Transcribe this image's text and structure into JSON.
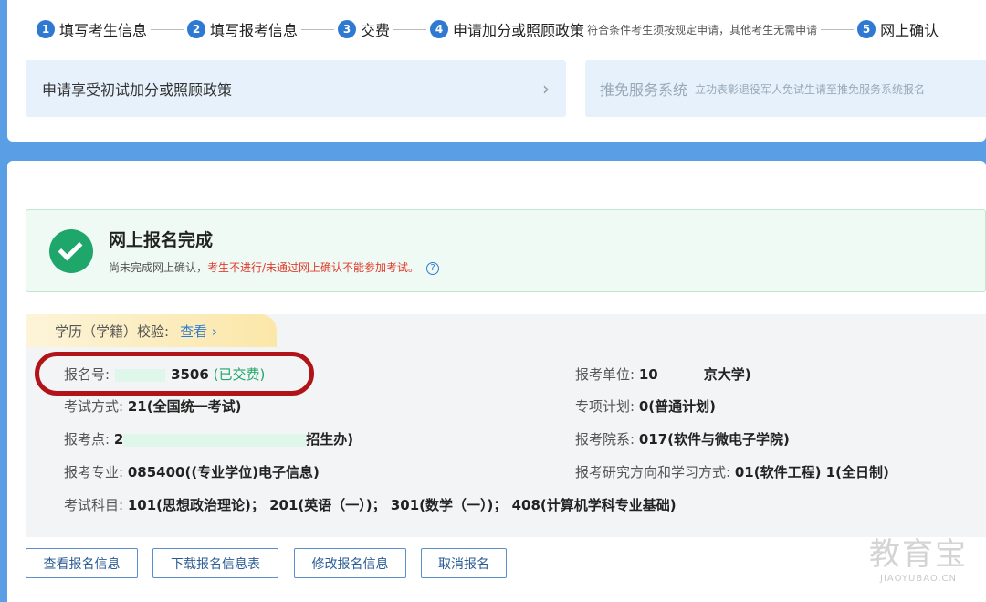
{
  "steps": [
    {
      "num": "1",
      "label": "填写考生信息"
    },
    {
      "num": "2",
      "label": "填写报考信息"
    },
    {
      "num": "3",
      "label": "交费"
    },
    {
      "num": "4",
      "label": "申请加分或照顾政策",
      "note": "符合条件考生须按规定申请，其他考生无需申请"
    },
    {
      "num": "5",
      "label": "网上确认"
    }
  ],
  "panels": {
    "bonus": {
      "label": "申请享受初试加分或照顾政策"
    },
    "exempt": {
      "title": "推免服务系统",
      "subtitle": "立功表彰退役军人免试生请至推免服务系统报名"
    }
  },
  "success": {
    "title": "网上报名完成",
    "sub_prefix": "尚未完成网上确认，",
    "sub_warning": "考生不进行/未通过网上确认不能参加考试。",
    "help": "?"
  },
  "education_tab": {
    "label": "学历（学籍）校验:",
    "link": "查看 ›"
  },
  "fields": {
    "reg_no": {
      "label": "报名号:",
      "value": "3506",
      "status": "(已交费)"
    },
    "exam_mode": {
      "label": "考试方式:",
      "value": "21(全国统一考试)"
    },
    "exam_site": {
      "label": "报考点:",
      "value_start": "2",
      "value_end": "招生办)"
    },
    "major": {
      "label": "报考专业:",
      "value": "085400((专业学位)电子信息)"
    },
    "subjects": {
      "label": "考试科目:",
      "value": "101(思想政治理论)； 201(英语（一）)； 301(数学（一）)； 408(计算机学科专业基础)"
    },
    "unit": {
      "label": "报考单位:",
      "value_start": "10",
      "value_end": "京大学)"
    },
    "special_plan": {
      "label": "专项计划:",
      "value": "0(普通计划)"
    },
    "department": {
      "label": "报考院系:",
      "value": "017(软件与微电子学院)"
    },
    "direction": {
      "label": "报考研究方向和学习方式:",
      "value": "01(软件工程) 1(全日制)"
    }
  },
  "buttons": {
    "view": "查看报名信息",
    "download": "下载报名信息表",
    "modify": "修改报名信息",
    "cancel": "取消报名"
  },
  "watermark": {
    "big": "教育宝",
    "small": "JIAOYUBAO.CN"
  },
  "colors": {
    "accent": "#2f7ad0",
    "success": "#1fa66a",
    "warning": "#e03c31",
    "highlight_ring": "#b01318"
  }
}
